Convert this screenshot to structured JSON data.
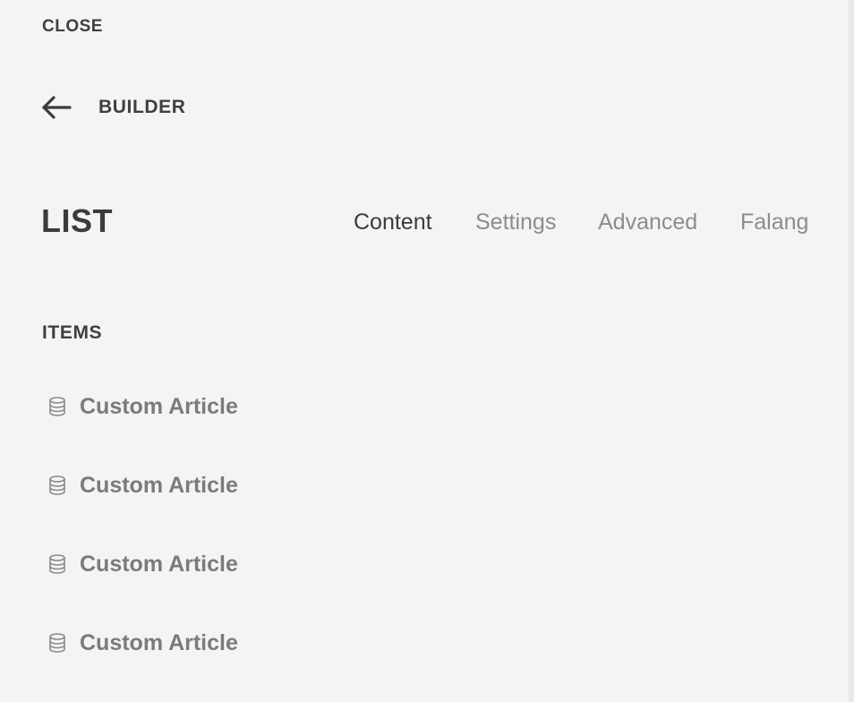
{
  "header": {
    "close_label": "CLOSE",
    "back_label": "BUILDER",
    "back_icon": "arrow-left-icon"
  },
  "element": {
    "title": "LIST"
  },
  "tabs": [
    {
      "label": "Content",
      "active": true
    },
    {
      "label": "Settings",
      "active": false
    },
    {
      "label": "Advanced",
      "active": false
    },
    {
      "label": "Falang",
      "active": false
    }
  ],
  "items_section": {
    "heading": "ITEMS",
    "item_icon": "database-icon",
    "items": [
      {
        "label": "Custom Article"
      },
      {
        "label": "Custom Article"
      },
      {
        "label": "Custom Article"
      },
      {
        "label": "Custom Article"
      }
    ]
  },
  "colors": {
    "background": "#f4f4f4",
    "text_dark": "#3b3b3b",
    "text_muted": "#8c8c8c",
    "item_text": "#7b7b7b"
  }
}
